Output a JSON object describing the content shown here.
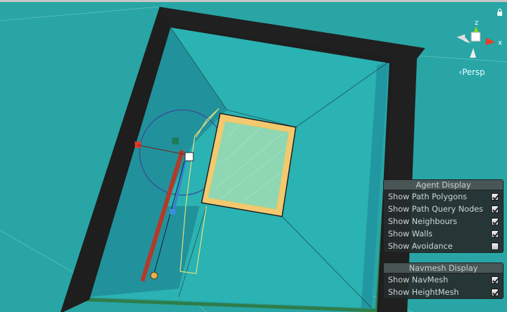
{
  "scene_view": {
    "projection_label": "Persp",
    "gizmo": {
      "y_axis": "z",
      "x_axis": "x"
    },
    "colors": {
      "background": "#2aa6a6",
      "wall": "#1f1f1f",
      "obstacle": "#f5d27a",
      "agent_path": "#b33a2a"
    }
  },
  "agent_display": {
    "title": "Agent Display",
    "options": [
      {
        "label": "Show Path Polygons",
        "checked": true
      },
      {
        "label": "Show Path Query Nodes",
        "checked": true
      },
      {
        "label": "Show Neighbours",
        "checked": true
      },
      {
        "label": "Show Walls",
        "checked": true
      },
      {
        "label": "Show Avoidance",
        "checked": false
      }
    ]
  },
  "navmesh_display": {
    "title": "Navmesh Display",
    "options": [
      {
        "label": "Show NavMesh",
        "checked": true
      },
      {
        "label": "Show HeightMesh",
        "checked": true
      }
    ]
  }
}
